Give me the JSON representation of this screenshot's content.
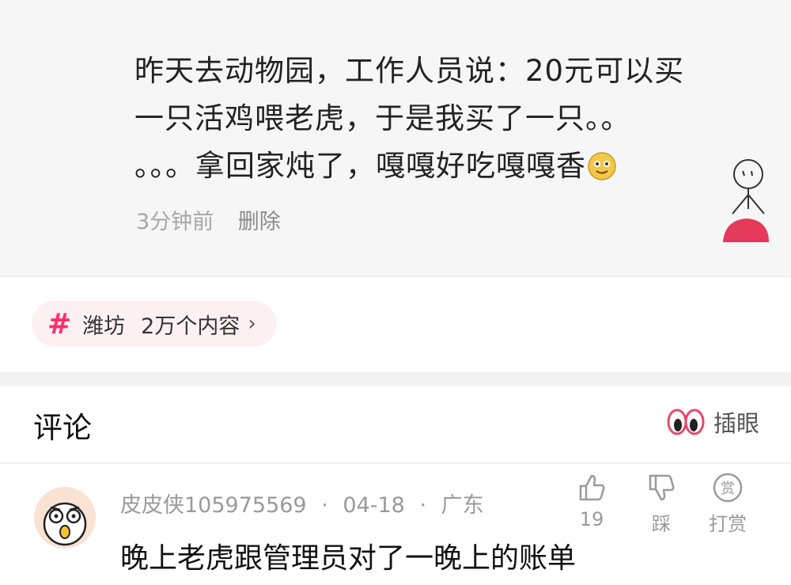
{
  "post": {
    "lines": [
      "昨天去动物园，工作人员说：20元可以买",
      "一只活鸡喂老虎，于是我买了一只。。",
      "。。。拿回家炖了，嘎嘎好吃嘎嘎香"
    ],
    "time": "3分钟前",
    "delete_label": "删除"
  },
  "topic": {
    "icon": "hash-icon",
    "name": "潍坊",
    "count": "2万个内容",
    "chevron": "›",
    "accent": "#ff2d6a"
  },
  "comments_header": {
    "title": "评论",
    "eyes_label": "插眼"
  },
  "comment": {
    "username": "皮皮侠105975569",
    "date": "04-18",
    "location": "广东",
    "separator": "·",
    "text": "晚上老虎跟管理员对了一晚上的账单",
    "like_count": "19",
    "dislike_label": "踩",
    "reward_icon_char": "赏",
    "reward_label": "打赏"
  }
}
